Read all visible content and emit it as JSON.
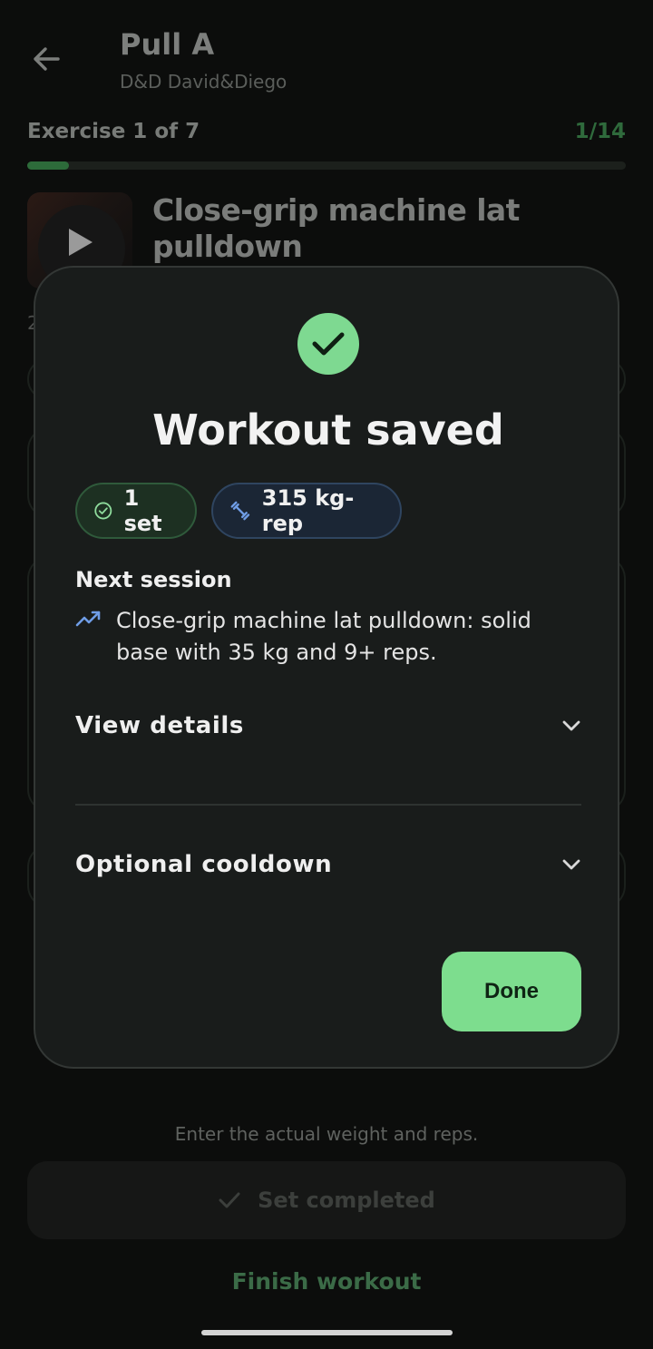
{
  "header": {
    "title": "Pull A",
    "subtitle": "D&D David&Diego"
  },
  "exercise": {
    "counter": "Exercise 1 of 7",
    "set_fraction": "1/14",
    "progress_fraction": 0.07,
    "name": "Close-grip machine lat pulldown",
    "partial_number": "2"
  },
  "footer": {
    "hint": "Enter the actual weight and reps.",
    "set_completed_label": "Set completed",
    "finish_label": "Finish workout"
  },
  "modal": {
    "title": "Workout saved",
    "chips": {
      "sets": "1 set",
      "volume": "315 kg-rep"
    },
    "next_session_label": "Next session",
    "next_session_text": "Close-grip machine lat pulldown: solid base with 35 kg and 9+ reps.",
    "view_details_label": "View details",
    "cooldown_label": "Optional cooldown",
    "done_label": "Done"
  },
  "colors": {
    "accent_green": "#7ddd8e",
    "chip_blue_icon": "#6f9de6",
    "modal_bg": "#191c1b"
  },
  "icons": [
    "back-arrow-icon",
    "play-icon",
    "check-icon",
    "check-circle-icon",
    "dumbbell-icon",
    "trending-up-icon",
    "chevron-down-icon"
  ]
}
